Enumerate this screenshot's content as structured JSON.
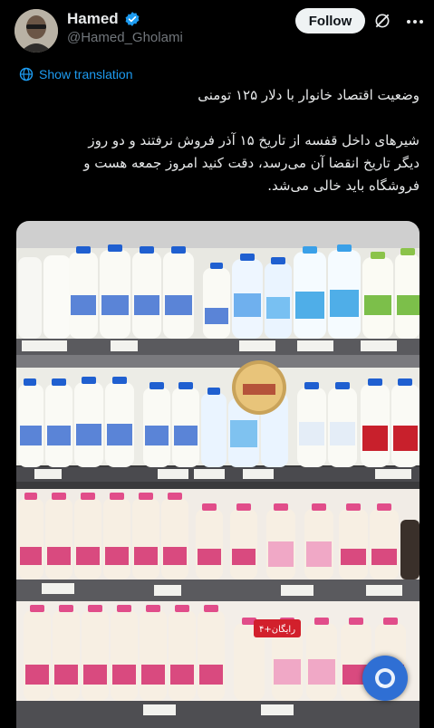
{
  "author": {
    "display_name": "Hamed",
    "handle": "@Hamed_Gholami",
    "verified": true
  },
  "actions": {
    "follow_label": "Follow",
    "grok_icon": "grok-icon",
    "more_icon": "more-icon"
  },
  "translation": {
    "label": "Show translation",
    "icon": "globe-icon"
  },
  "tweet": {
    "line1": "وضعیت اقتصاد خانوار با دلار ۱۲۵ تومنی",
    "line2": "شیرهای داخل قفسه از تاریخ ۱۵ آذر فروش نرفتند و دو روز",
    "line3": "دیگر تاریخ انقضا آن می‌رسد، دقت کنید امروز جمعه هست و",
    "line4": "فروشگاه باید خالی می‌شد."
  },
  "media": {
    "description_icon": "milk-shelf-photo",
    "promo_label": "۴+رایگان"
  },
  "colors": {
    "background": "#000000",
    "text": "#e7e9ea",
    "secondary": "#71767b",
    "link": "#1d9bf0",
    "verified": "#1d9bf0",
    "blue_cap": "#1f5fd0",
    "pink_cap": "#e14d8a"
  }
}
